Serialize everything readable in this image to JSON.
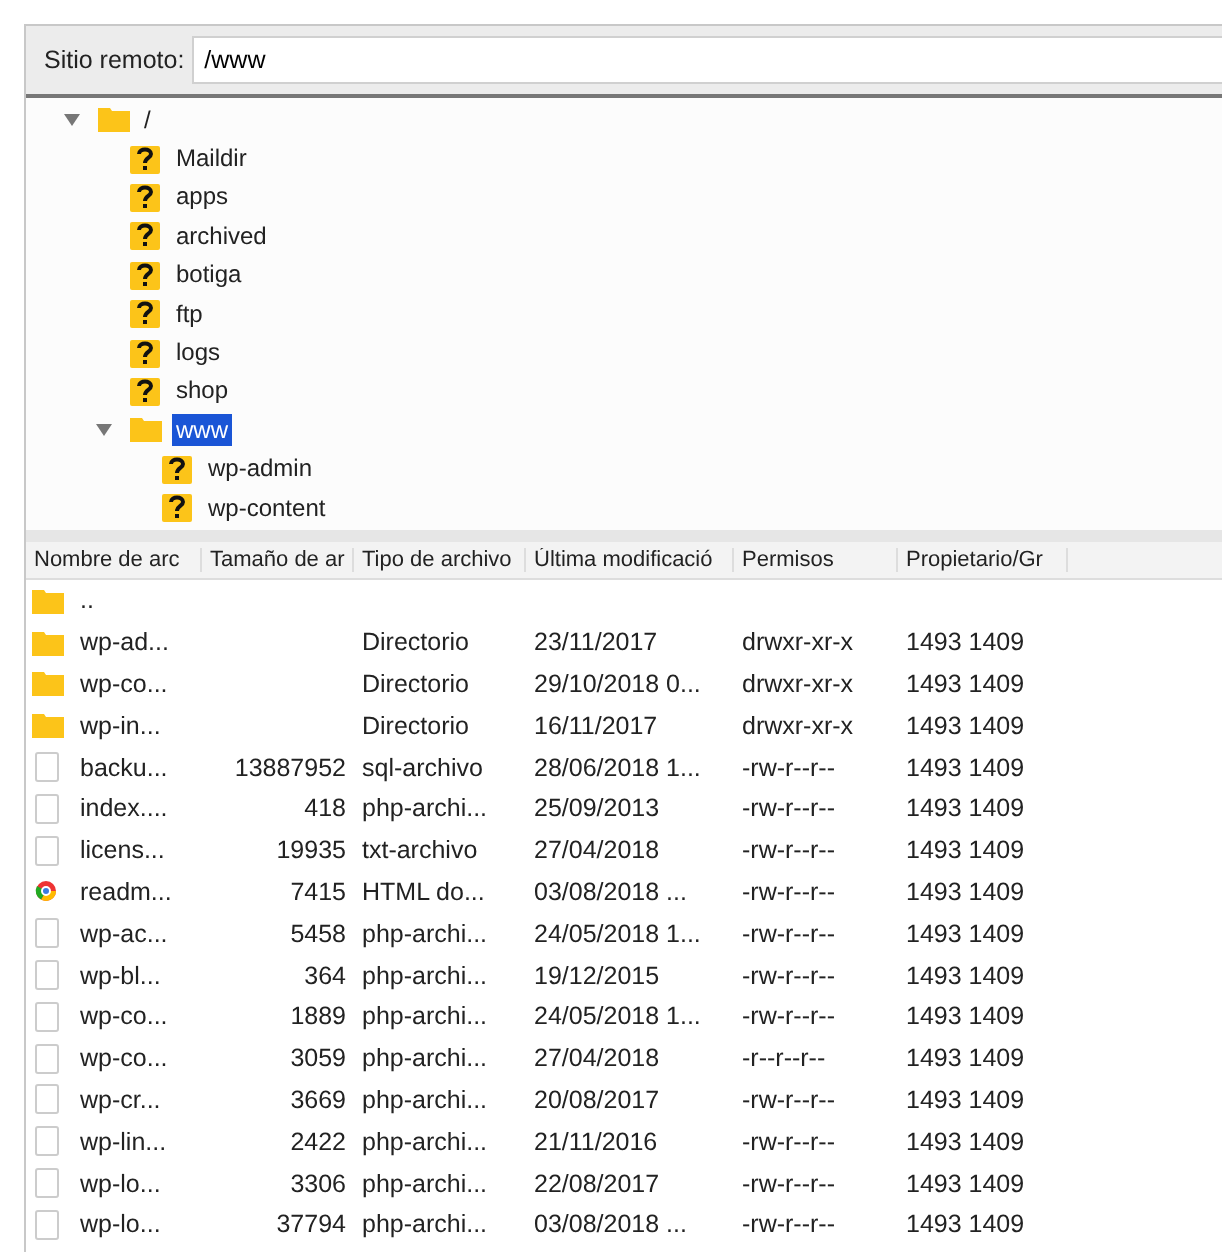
{
  "remote_site": {
    "label": "Sitio remoto:",
    "value": "/www"
  },
  "tree": [
    {
      "name": "/",
      "kind": "folder",
      "expanded": true,
      "selected": false,
      "children": [
        {
          "name": "Maildir",
          "kind": "unknown",
          "selected": false
        },
        {
          "name": "apps",
          "kind": "unknown",
          "selected": false
        },
        {
          "name": "archived",
          "kind": "unknown",
          "selected": false
        },
        {
          "name": "botiga",
          "kind": "unknown",
          "selected": false
        },
        {
          "name": "ftp",
          "kind": "unknown",
          "selected": false
        },
        {
          "name": "logs",
          "kind": "unknown",
          "selected": false
        },
        {
          "name": "shop",
          "kind": "unknown",
          "selected": false
        },
        {
          "name": "www",
          "kind": "folder",
          "expanded": true,
          "selected": true,
          "children": [
            {
              "name": "wp-admin",
              "kind": "unknown",
              "selected": false
            },
            {
              "name": "wp-content",
              "kind": "unknown",
              "selected": false
            }
          ]
        }
      ]
    }
  ],
  "table": {
    "columns": [
      "Nombre de arc",
      "Tamaño de ar",
      "Tipo de archivo",
      "Última modificació",
      "Permisos",
      "Propietario/Gr"
    ],
    "rows": [
      {
        "kind": "folder",
        "cells": [
          "..",
          "",
          "",
          "",
          "",
          ""
        ]
      },
      {
        "kind": "folder",
        "cells": [
          "wp-ad...",
          "",
          "Directorio",
          "23/11/2017",
          "drwxr-xr-x",
          "1493 1409"
        ]
      },
      {
        "kind": "folder",
        "cells": [
          "wp-co...",
          "",
          "Directorio",
          "29/10/2018 0...",
          "drwxr-xr-x",
          "1493 1409"
        ]
      },
      {
        "kind": "folder",
        "cells": [
          "wp-in...",
          "",
          "Directorio",
          "16/11/2017",
          "drwxr-xr-x",
          "1493 1409"
        ]
      },
      {
        "kind": "file",
        "cells": [
          "backu...",
          "13887952",
          "sql-archivo",
          "28/06/2018 1...",
          "-rw-r--r--",
          "1493 1409"
        ]
      },
      {
        "kind": "file",
        "cells": [
          "index....",
          "418",
          "php-archi...",
          "25/09/2013",
          "-rw-r--r--",
          "1493 1409"
        ]
      },
      {
        "kind": "file",
        "cells": [
          "licens...",
          "19935",
          "txt-archivo",
          "27/04/2018",
          "-rw-r--r--",
          "1493 1409"
        ]
      },
      {
        "kind": "html",
        "cells": [
          "readm...",
          "7415",
          "HTML do...",
          "03/08/2018 ...",
          "-rw-r--r--",
          "1493 1409"
        ]
      },
      {
        "kind": "file",
        "cells": [
          "wp-ac...",
          "5458",
          "php-archi...",
          "24/05/2018 1...",
          "-rw-r--r--",
          "1493 1409"
        ]
      },
      {
        "kind": "file",
        "cells": [
          "wp-bl...",
          "364",
          "php-archi...",
          "19/12/2015",
          "-rw-r--r--",
          "1493 1409"
        ]
      },
      {
        "kind": "file",
        "cells": [
          "wp-co...",
          "1889",
          "php-archi...",
          "24/05/2018 1...",
          "-rw-r--r--",
          "1493 1409"
        ]
      },
      {
        "kind": "file",
        "cells": [
          "wp-co...",
          "3059",
          "php-archi...",
          "27/04/2018",
          "-r--r--r--",
          "1493 1409"
        ]
      },
      {
        "kind": "file",
        "cells": [
          "wp-cr...",
          "3669",
          "php-archi...",
          "20/08/2017",
          "-rw-r--r--",
          "1493 1409"
        ]
      },
      {
        "kind": "file",
        "cells": [
          "wp-lin...",
          "2422",
          "php-archi...",
          "21/11/2016",
          "-rw-r--r--",
          "1493 1409"
        ]
      },
      {
        "kind": "file",
        "cells": [
          "wp-lo...",
          "3306",
          "php-archi...",
          "22/08/2017",
          "-rw-r--r--",
          "1493 1409"
        ]
      },
      {
        "kind": "file",
        "cells": [
          "wp-lo...",
          "37794",
          "php-archi...",
          "03/08/2018 ...",
          "-rw-r--r--",
          "1493 1409"
        ]
      }
    ]
  }
}
